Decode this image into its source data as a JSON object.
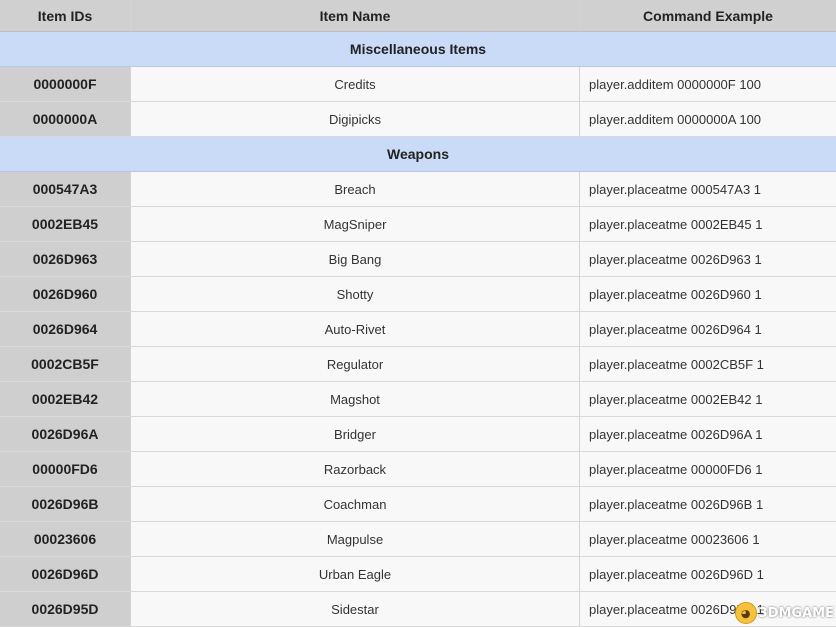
{
  "table": {
    "headers": [
      "Item IDs",
      "Item Name",
      "Command Example"
    ],
    "sections": [
      {
        "title": "Miscellaneous Items",
        "rows": [
          {
            "id": "0000000F",
            "name": "Credits",
            "command": "player.additem 0000000F 100"
          },
          {
            "id": "0000000A",
            "name": "Digipicks",
            "command": "player.additem 0000000A 100"
          }
        ]
      },
      {
        "title": "Weapons",
        "rows": [
          {
            "id": "000547A3",
            "name": "Breach",
            "command": "player.placeatme 000547A3 1"
          },
          {
            "id": "0002EB45",
            "name": "MagSniper",
            "command": "player.placeatme 0002EB45 1"
          },
          {
            "id": "0026D963",
            "name": "Big Bang",
            "command": "player.placeatme 0026D963 1"
          },
          {
            "id": "0026D960",
            "name": "Shotty",
            "command": "player.placeatme 0026D960 1"
          },
          {
            "id": "0026D964",
            "name": "Auto-Rivet",
            "command": "player.placeatme 0026D964 1"
          },
          {
            "id": "0002CB5F",
            "name": "Regulator",
            "command": "player.placeatme 0002CB5F 1"
          },
          {
            "id": "0002EB42",
            "name": "Magshot",
            "command": "player.placeatme 0002EB42 1"
          },
          {
            "id": "0026D96A",
            "name": "Bridger",
            "command": "player.placeatme 0026D96A 1"
          },
          {
            "id": "00000FD6",
            "name": "Razorback",
            "command": "player.placeatme 00000FD6 1"
          },
          {
            "id": "0026D96B",
            "name": "Coachman",
            "command": "player.placeatme 0026D96B 1"
          },
          {
            "id": "00023606",
            "name": "Magpulse",
            "command": "player.placeatme 00023606 1"
          },
          {
            "id": "0026D96D",
            "name": "Urban Eagle",
            "command": "player.placeatme 0026D96D 1"
          },
          {
            "id": "0026D95D",
            "name": "Sidestar",
            "command": "player.placeatme 0026D95D 1"
          }
        ]
      }
    ]
  },
  "watermark": {
    "text": "3DMGAME",
    "icon": "mascot-face-icon"
  }
}
